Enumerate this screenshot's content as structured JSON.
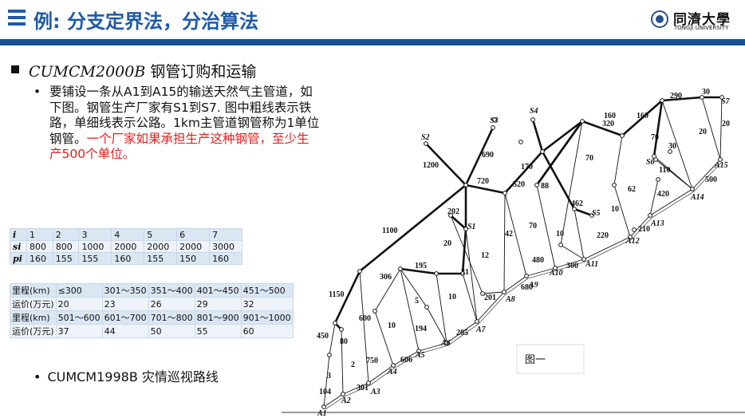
{
  "header": {
    "title": "例: 分支定界法，分治算法",
    "logo_cn": "同濟大學",
    "logo_en": "TONGJI UNIVERSITY",
    "accent": "#1f5aa6"
  },
  "section": {
    "title_italic": "CUMCM2000B",
    "title_rest": " 钢管订购和运输"
  },
  "paragraph": {
    "bullet": "•",
    "black": "要铺设一条从A1到A15的输送天然气主管道，如下图。钢管生产厂家有S1到S7. 图中粗线表示铁路，单细线表示公路。1km主管道钢管称为1单位钢管。",
    "red": "一个厂家如果承担生产这种钢管，至少生产500个单位。"
  },
  "table1": {
    "rows": [
      {
        "head": "i",
        "cells": [
          "1",
          "2",
          "3",
          "4",
          "5",
          "6",
          "7"
        ]
      },
      {
        "head": "si",
        "cells": [
          "800",
          "800",
          "1000",
          "2000",
          "2000",
          "2000",
          "3000"
        ]
      },
      {
        "head": "pi",
        "cells": [
          "160",
          "155",
          "155",
          "160",
          "155",
          "150",
          "160"
        ]
      }
    ]
  },
  "table2": {
    "rows": [
      [
        "里程(km)",
        "≤300",
        "301～350",
        "351～400",
        "401～450",
        "451～500"
      ],
      [
        "运价(万元)",
        "20",
        "23",
        "26",
        "29",
        "32"
      ],
      [
        "里程(km)",
        "501～600",
        "601～700",
        "701～800",
        "801～900",
        "901～1000"
      ],
      [
        "运价(万元)",
        "37",
        "44",
        "50",
        "55",
        "60"
      ]
    ]
  },
  "bullet2": {
    "dot": "•",
    "text": "CUMCM1998B 灾情巡视路线"
  },
  "figure": {
    "caption": "图一",
    "node_labels": [
      "A1",
      "A2",
      "A3",
      "A4",
      "A5",
      "A6",
      "A7",
      "A8",
      "A9",
      "A10",
      "A11",
      "A12",
      "A13",
      "A14",
      "A15",
      "S1",
      "S2",
      "S3",
      "S4",
      "S5",
      "S6",
      "S7"
    ],
    "edge_labels": [
      "290",
      "30",
      "20",
      "20",
      "160",
      "320",
      "160",
      "70",
      "30",
      "110",
      "500",
      "70",
      "690",
      "170",
      "88",
      "462",
      "10",
      "62",
      "420",
      "1200",
      "720",
      "520",
      "202",
      "20",
      "42",
      "70",
      "10",
      "220",
      "210",
      "1100",
      "195",
      "31",
      "12",
      "480",
      "300",
      "306",
      "5",
      "10",
      "201",
      "680",
      "1150",
      "600",
      "10",
      "194",
      "205",
      "450",
      "80",
      "750",
      "606",
      "3",
      "2",
      "104",
      "301"
    ]
  }
}
